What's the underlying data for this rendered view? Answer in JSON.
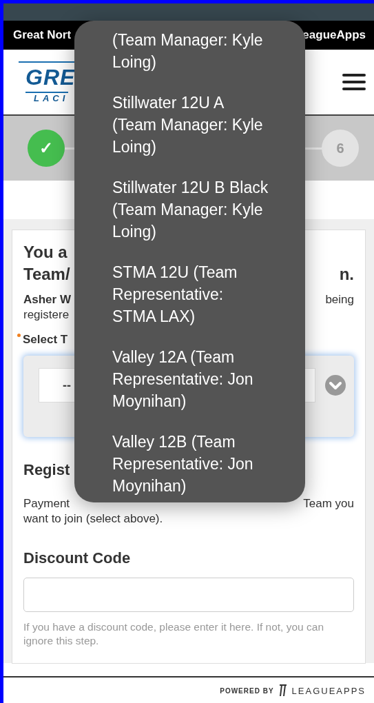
{
  "top_bar": {
    "left_text": "Great Nort",
    "right_text": "eagueApps"
  },
  "header": {
    "logo_words": [
      "GRE",
      "LACI"
    ]
  },
  "steps": [
    {
      "label": "✓",
      "done": true
    },
    {
      "label": "6",
      "done": false
    }
  ],
  "card": {
    "heading_lines": [
      {
        "left": "You a"
      },
      {
        "left": "Team/",
        "right": "n."
      }
    ],
    "athlete": {
      "name": "Asher W",
      "right": "being",
      "line2": "registere"
    },
    "select_label": "Select T",
    "select_value": "--",
    "registration_heading": "Regist",
    "payment": {
      "left": "Payment",
      "right": "Team you",
      "line2": "want to join (select above)."
    },
    "discount_heading": "Discount Code",
    "discount_hint": "If you have a discount code, please enter it here. If not, you can ignore this step."
  },
  "footer": {
    "powered": "POWERED BY",
    "brand": "LEAGUEAPPS"
  },
  "dropdown": {
    "options": [
      {
        "label": "(Team Manager: Kyle Loing)",
        "selected": false
      },
      {
        "label": "Stillwater 12U A (Team Manager: Kyle Loing)",
        "selected": false
      },
      {
        "label": "Stillwater 12U B Black (Team Manager: Kyle Loing)",
        "selected": false
      },
      {
        "label": "STMA 12U (Team Representative: STMA LAX)",
        "selected": false
      },
      {
        "label": "Valley 12A (Team Representative: Jon Moynihan)",
        "selected": false
      },
      {
        "label": "Valley 12B (Team Representative: Jon Moynihan)",
        "selected": false
      }
    ]
  }
}
